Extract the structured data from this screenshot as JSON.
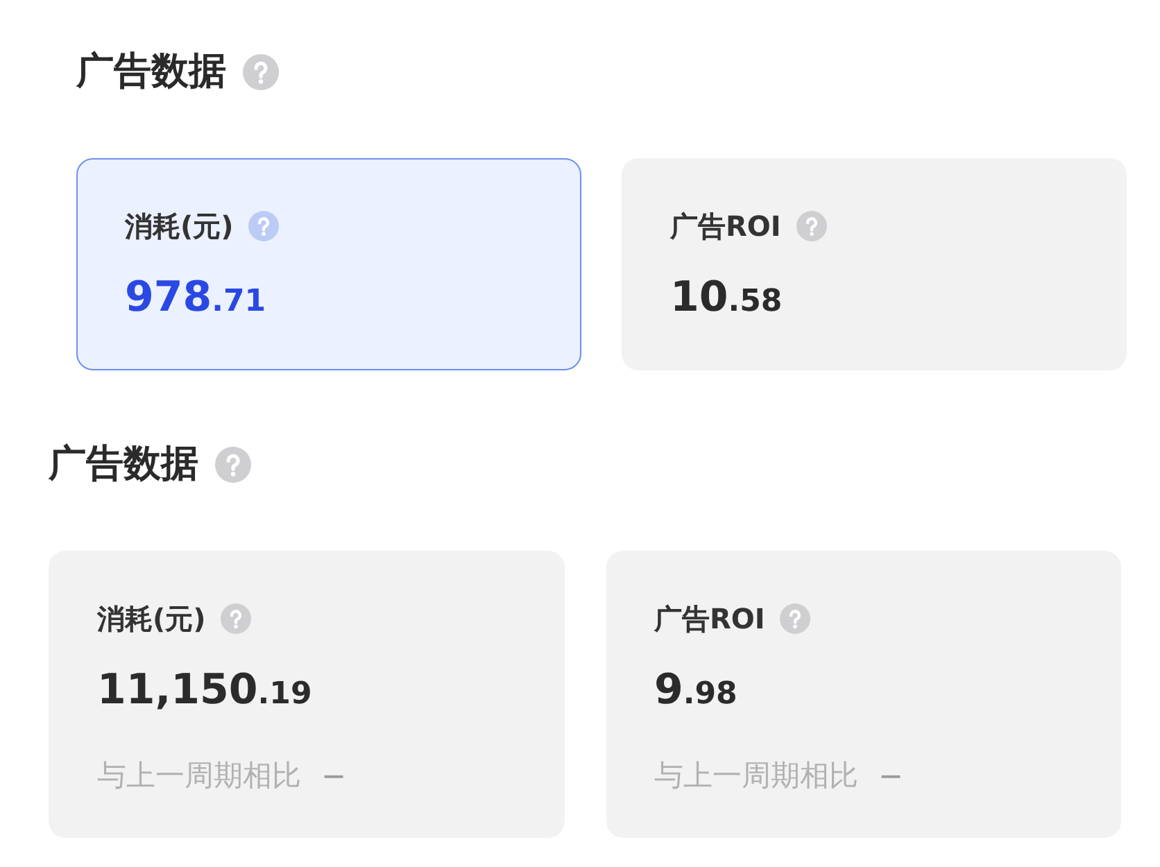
{
  "sections": [
    {
      "title": "广告数据",
      "cards": [
        {
          "label": "消耗(元)",
          "value": "978",
          "decimals": ".71",
          "selected": true
        },
        {
          "label": "广告ROI",
          "value": "10",
          "decimals": ".58",
          "selected": false
        }
      ]
    },
    {
      "title": "广告数据",
      "cards": [
        {
          "label": "消耗(元)",
          "value": "11,150",
          "decimals": ".19",
          "selected": false,
          "comparison": {
            "label": "与上一周期相比",
            "change": "—"
          }
        },
        {
          "label": "广告ROI",
          "value": "9",
          "decimals": ".98",
          "selected": false,
          "comparison": {
            "label": "与上一周期相比",
            "change": "—"
          }
        }
      ]
    }
  ]
}
